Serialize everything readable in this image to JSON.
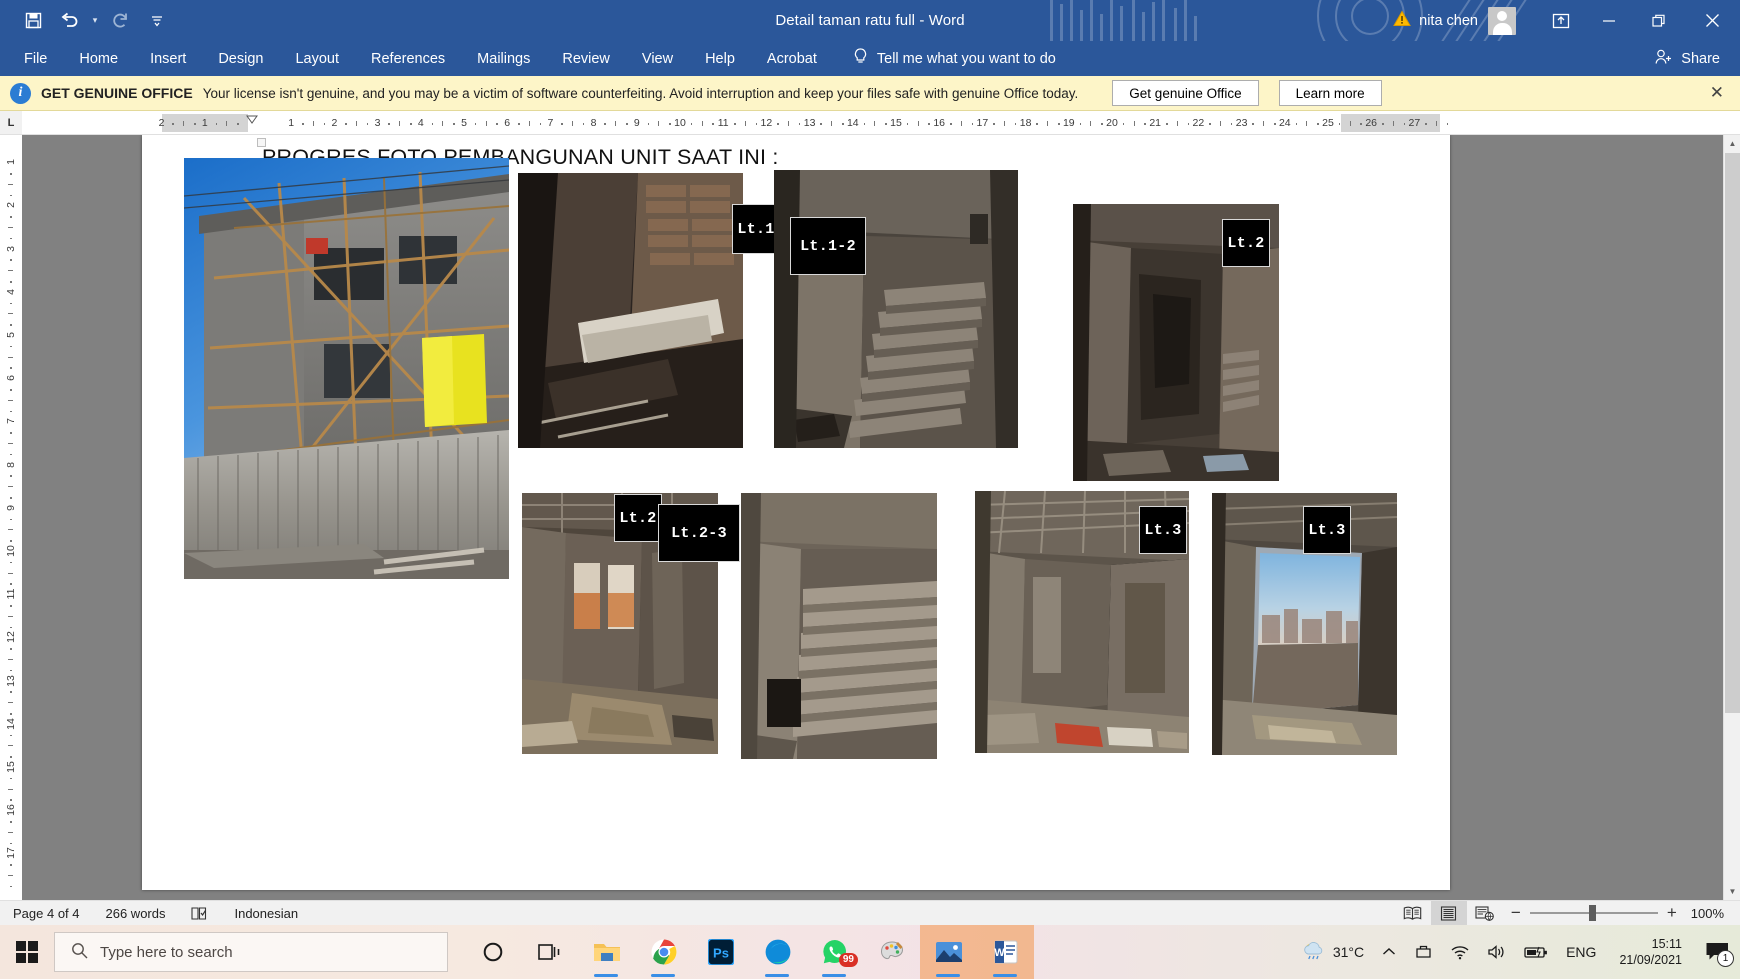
{
  "titlebar": {
    "document_title": "Detail taman ratu full  -  Word",
    "user_name": "nita chen",
    "quick_access": [
      {
        "name": "save",
        "glyph": "💾"
      },
      {
        "name": "undo",
        "glyph": "↶"
      },
      {
        "name": "redo",
        "glyph": "↻"
      },
      {
        "name": "customize",
        "glyph": "≡"
      }
    ],
    "warning_glyph": "⚠",
    "ribbon_display_glyph": "⬆",
    "minimize_glyph": "─",
    "restore_glyph": "❐",
    "close_glyph": "✕"
  },
  "menubar": {
    "tabs": [
      "File",
      "Home",
      "Insert",
      "Design",
      "Layout",
      "References",
      "Mailings",
      "Review",
      "View",
      "Help",
      "Acrobat"
    ],
    "tellme": "Tell me what you want to do",
    "tellme_glyph": "💡",
    "share": "Share"
  },
  "banner": {
    "icon_letter": "i",
    "title": "GET GENUINE OFFICE",
    "message": "Your license isn't genuine, and you may be a victim of software counterfeiting. Avoid interruption and keep your files safe with genuine Office today.",
    "primary_button": "Get genuine Office",
    "secondary_button": "Learn more",
    "close_glyph": "✕"
  },
  "ruler": {
    "corner_label": "L",
    "horizontal_marks": [
      "2",
      "1",
      "1",
      "2",
      "3",
      "4",
      "5",
      "6",
      "7",
      "8",
      "9",
      "10",
      "11",
      "12",
      "13",
      "14",
      "15",
      "16",
      "17",
      "18",
      "19",
      "20",
      "21",
      "22",
      "23",
      "24",
      "26",
      "27"
    ],
    "vertical_marks": [
      "2",
      "3",
      "4",
      "5",
      "6",
      "7",
      "8",
      "9",
      "10",
      "11",
      "12",
      "13",
      "14",
      "15",
      "16"
    ]
  },
  "document": {
    "heading": "PROGRES FOTO PEMBANGUNAN UNIT SAAT INI :",
    "photos": [
      {
        "name": "photo-exterior-building",
        "tag": null
      },
      {
        "name": "photo-interior-rubble",
        "tag": "Lt.1"
      },
      {
        "name": "photo-stairs-lt1-2",
        "tag": "Lt.1-2"
      },
      {
        "name": "photo-room-lt2",
        "tag": "Lt.2"
      },
      {
        "name": "photo-room-lt2-b",
        "tag": "Lt.2"
      },
      {
        "name": "photo-stairs-lt2-3",
        "tag": "Lt.2-3"
      },
      {
        "name": "photo-room-lt3",
        "tag": "Lt.3"
      },
      {
        "name": "photo-window-lt3",
        "tag": "Lt.3"
      }
    ]
  },
  "statusbar": {
    "page": "Page 4 of 4",
    "words": "266 words",
    "proofing_glyph": "📖",
    "language": "Indonesian",
    "views": [
      {
        "name": "read-mode",
        "glyph": "📖",
        "active": false
      },
      {
        "name": "print-layout",
        "glyph": "▤",
        "active": true
      },
      {
        "name": "web-layout",
        "glyph": "🗋",
        "active": false
      }
    ],
    "zoom_out_glyph": "−",
    "zoom_in_glyph": "+",
    "zoom_value": "100%"
  },
  "taskbar": {
    "search_placeholder": "Type here to search",
    "search_glyph": "🔍",
    "icons": [
      {
        "name": "cortana-icon",
        "glyph": "O"
      },
      {
        "name": "task-view-icon",
        "glyph": "□"
      },
      {
        "name": "file-explorer-icon",
        "glyph": "📁"
      },
      {
        "name": "google-chrome-icon",
        "glyph": ""
      },
      {
        "name": "photoshop-icon",
        "glyph": "Ps"
      },
      {
        "name": "microsoft-edge-icon",
        "glyph": ""
      },
      {
        "name": "whatsapp-icon",
        "glyph": "",
        "badge": "99"
      },
      {
        "name": "paint-icon",
        "glyph": "🎨"
      },
      {
        "name": "photos-icon",
        "glyph": ""
      },
      {
        "name": "word-icon",
        "glyph": "W"
      }
    ],
    "tray": {
      "weather_temp": "31°C",
      "weather_glyph": "🌦",
      "chevron_glyph": "⌃",
      "onedrive_glyph": "☁",
      "network_glyph": "📶",
      "volume_glyph": "🔊",
      "battery_glyph": "🔋",
      "language": "ENG",
      "time": "15:11",
      "date": "21/09/2021",
      "notification_count": "1"
    }
  },
  "colors": {
    "word_blue": "#2b579a",
    "banner_yellow": "#fdf5c8",
    "doc_gray": "#818181",
    "accent_orange": "#f2964b"
  }
}
